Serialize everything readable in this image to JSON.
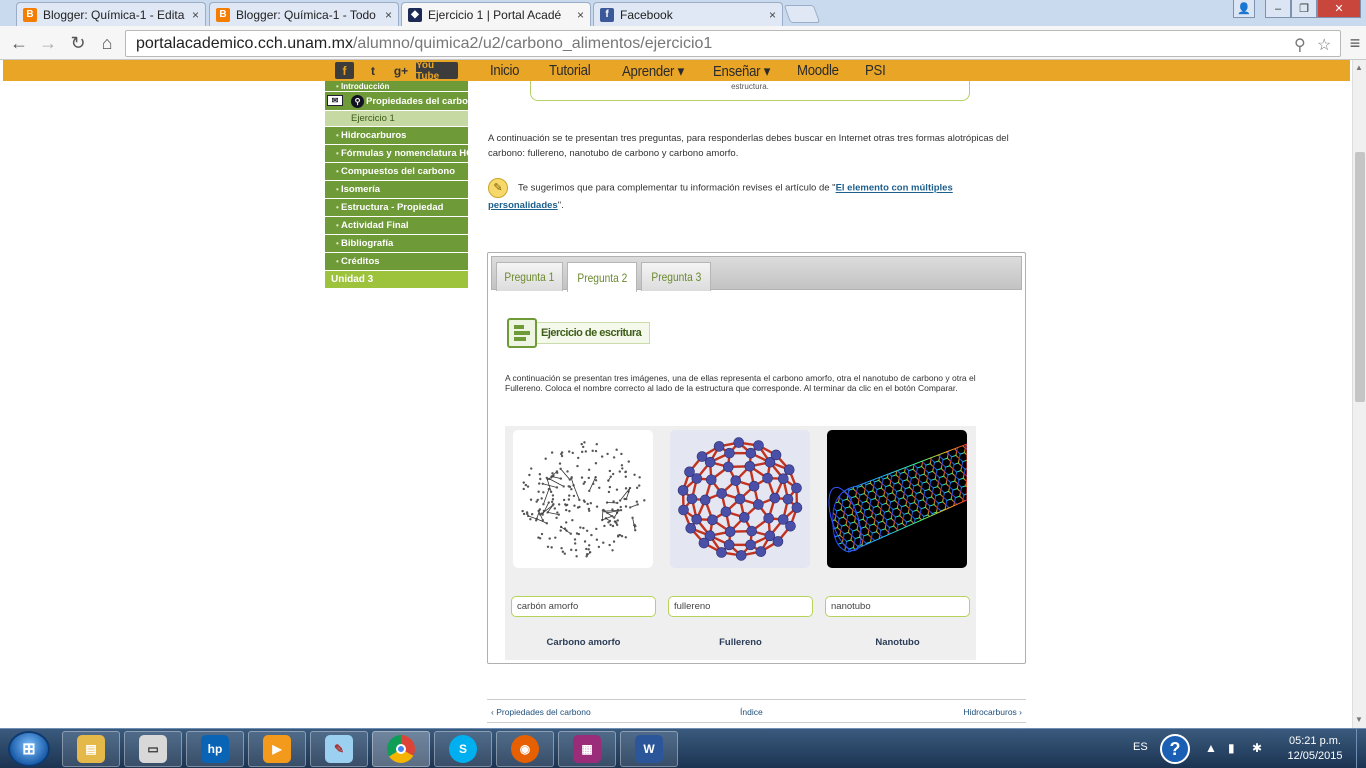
{
  "browser": {
    "tabs": [
      {
        "title": "Blogger: Química-1 - Edita",
        "favicon": "blogger-icon",
        "active": false
      },
      {
        "title": "Blogger: Química-1 - Todo",
        "favicon": "blogger-icon",
        "active": false
      },
      {
        "title": "Ejercicio 1 | Portal Acadé",
        "favicon": "unam-icon",
        "active": true
      },
      {
        "title": "Facebook",
        "favicon": "facebook-icon",
        "active": false
      }
    ],
    "tab_close": "×",
    "url_host": "portalacademico.cch.unam.mx",
    "url_path": "/alumno/quimica2/u2/carbono_alimentos/ejercicio1"
  },
  "site": {
    "social": [
      "f",
      "t",
      "g+",
      "You Tube"
    ],
    "menu": [
      "Inicio",
      "Tutorial",
      "Aprender ▾",
      "Enseñar ▾",
      "Moodle",
      "PSI"
    ]
  },
  "sidebar": {
    "top_item": "Introducción",
    "current_section": "Propiedades del carbono",
    "current_sub": "Ejercicio 1",
    "items": [
      "Hidrocarburos",
      "Fórmulas y nomenclatura HC",
      "Compuestos del carbono",
      "Isomería",
      "Estructura - Propiedad",
      "Actividad Final",
      "Bibliografía",
      "Créditos"
    ],
    "unit": "Unidad 3"
  },
  "content": {
    "box_tail": "estructura.",
    "intro": "A continuación se te presentan tres preguntas, para responderlas debes buscar en Internet otras tres formas alotrópicas del carbono: fullereno, nanotubo de carbono y carbono amorfo.",
    "suggestion_before": "Te sugerimos que para complementar tu información revises el artículo de \"",
    "suggestion_link": "El elemento con múltiples personalidades",
    "suggestion_after": "\".",
    "question_tabs": [
      "Pregunta 1",
      "Pregunta 2",
      "Pregunta 3"
    ],
    "active_question": 1,
    "exercise_label": "Ejercicio de escritura",
    "instructions": "A continuación se presentan tres imágenes, una de ellas representa el carbono amorfo, otra el nanotubo de carbono y otra el Fullereno. Coloca el nombre correcto al lado de la estructura que corresponde. Al terminar da clic en el botón Comparar.",
    "cards": [
      {
        "answer": "carbón amorfo",
        "caption": "Carbono amorfo"
      },
      {
        "answer": "fullereno",
        "caption": "Fullereno"
      },
      {
        "answer": "nanotubo",
        "caption": "Nanotubo"
      }
    ],
    "pager": {
      "prev": "‹ Propiedades del carbono",
      "index": "Índice",
      "next": "Hidrocarburos ›"
    }
  },
  "taskbar": {
    "lang": "ES",
    "help": "?",
    "time": "05:21 p.m.",
    "date": "12/05/2015"
  },
  "colors": {
    "site_bar": "#e9a526",
    "sidebar_green": "#6f9a38",
    "accent_lime": "#9dc23b",
    "link": "#1d5f8c"
  }
}
